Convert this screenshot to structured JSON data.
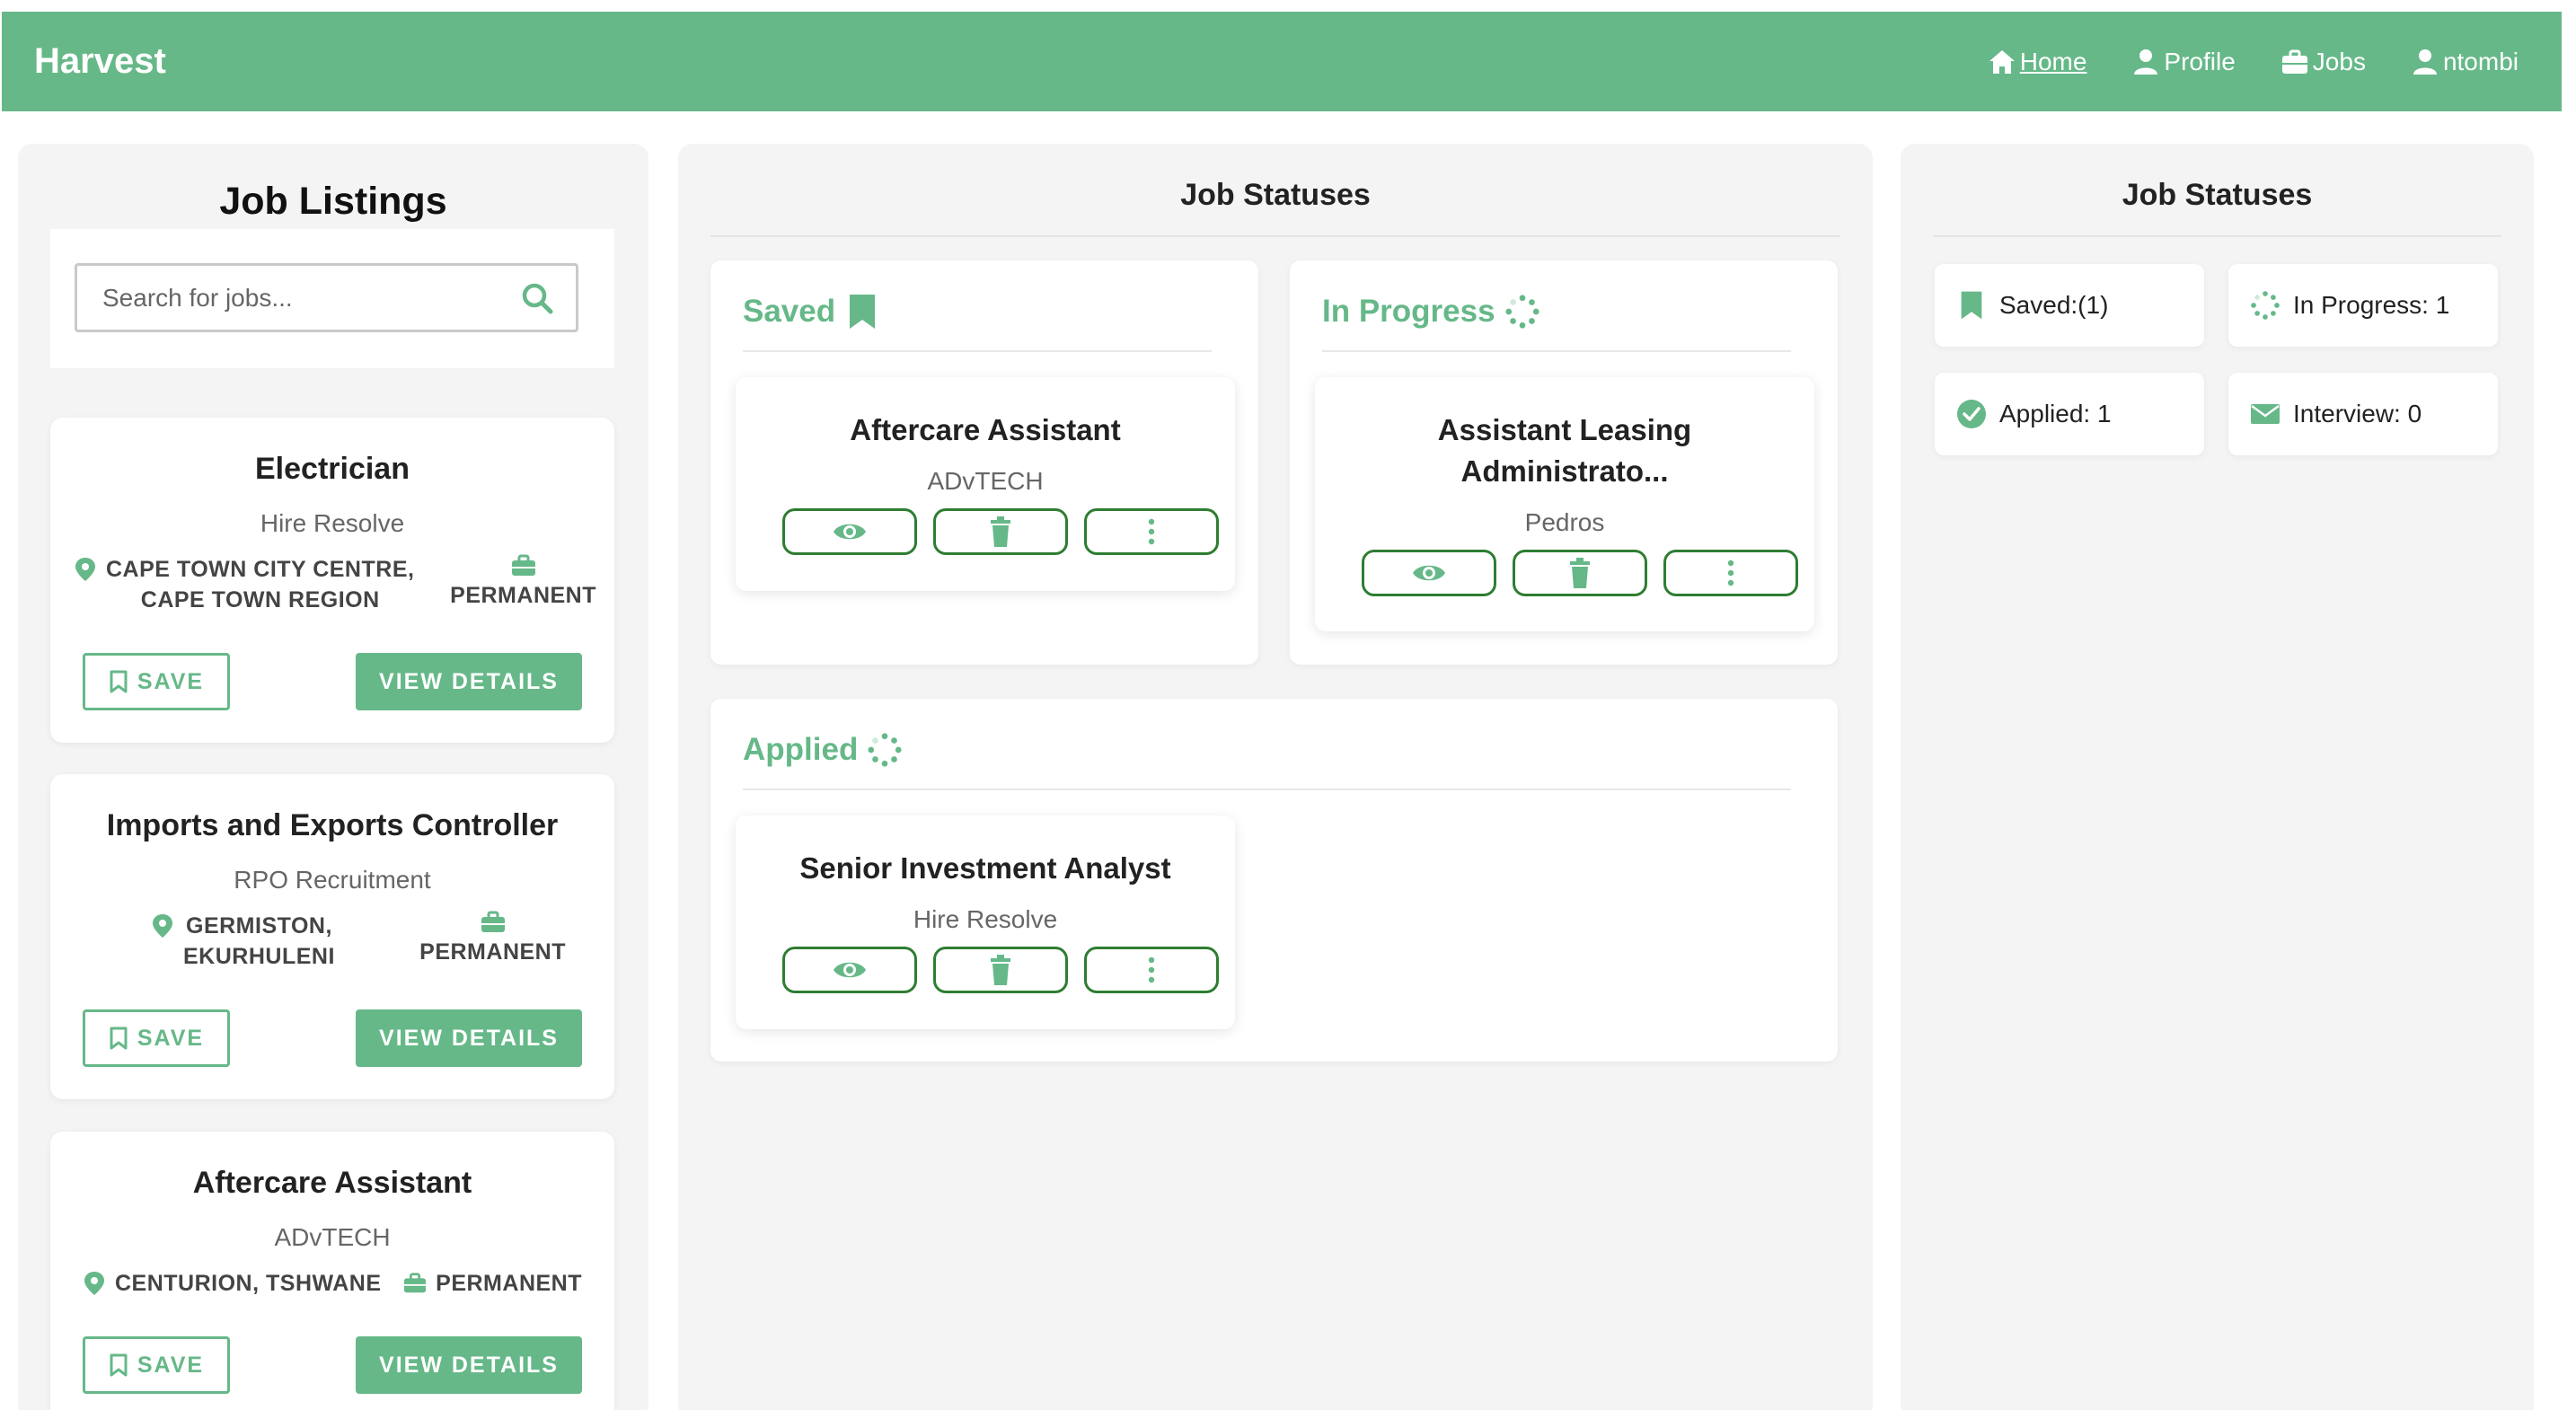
{
  "navbar": {
    "brand": "Harvest",
    "links": [
      {
        "label": "Home",
        "icon": "home-icon"
      },
      {
        "label": "Profile",
        "icon": "user-icon"
      },
      {
        "label": "Jobs",
        "icon": "briefcase-icon"
      },
      {
        "label": "ntombi",
        "icon": "user-icon"
      }
    ]
  },
  "listings": {
    "title": "Job Listings",
    "search_placeholder": "Search for jobs...",
    "save_label": "SAVE",
    "view_label": "VIEW DETAILS",
    "jobs": [
      {
        "title": "Electrician",
        "company": "Hire Resolve",
        "location_line1": "CAPE TOWN CITY CENTRE,",
        "location_line2": "CAPE TOWN REGION",
        "type": "PERMANENT"
      },
      {
        "title": "Imports and Exports Controller",
        "company": "RPO Recruitment",
        "location_line1": "GERMISTON,",
        "location_line2": "EKURHULENI",
        "type": "PERMANENT"
      },
      {
        "title": "Aftercare Assistant",
        "company": "ADvTECH",
        "location": "CENTURION, TSHWANE",
        "type": "PERMANENT"
      }
    ]
  },
  "statuses": {
    "title": "Job Statuses",
    "saved": {
      "heading": "Saved",
      "card": {
        "title": "Aftercare Assistant",
        "company": "ADvTECH"
      }
    },
    "in_progress": {
      "heading": "In Progress",
      "card": {
        "title": "Assistant Leasing Administrato...",
        "company": "Pedros"
      }
    },
    "applied": {
      "heading": "Applied",
      "card": {
        "title": "Senior Investment Analyst",
        "company": "Hire Resolve"
      }
    }
  },
  "summary": {
    "title": "Job Statuses",
    "tiles": [
      {
        "label": "Saved:(1)",
        "icon": "bookmark-icon"
      },
      {
        "label": "In Progress: 1",
        "icon": "spinner-icon"
      },
      {
        "label": "Applied: 1",
        "icon": "check-circle-icon"
      },
      {
        "label": "Interview: 0",
        "icon": "envelope-icon"
      }
    ]
  },
  "colors": {
    "accent": "#66b888",
    "dark_green": "#2e7d32",
    "panel_bg": "#f4f4f4"
  }
}
